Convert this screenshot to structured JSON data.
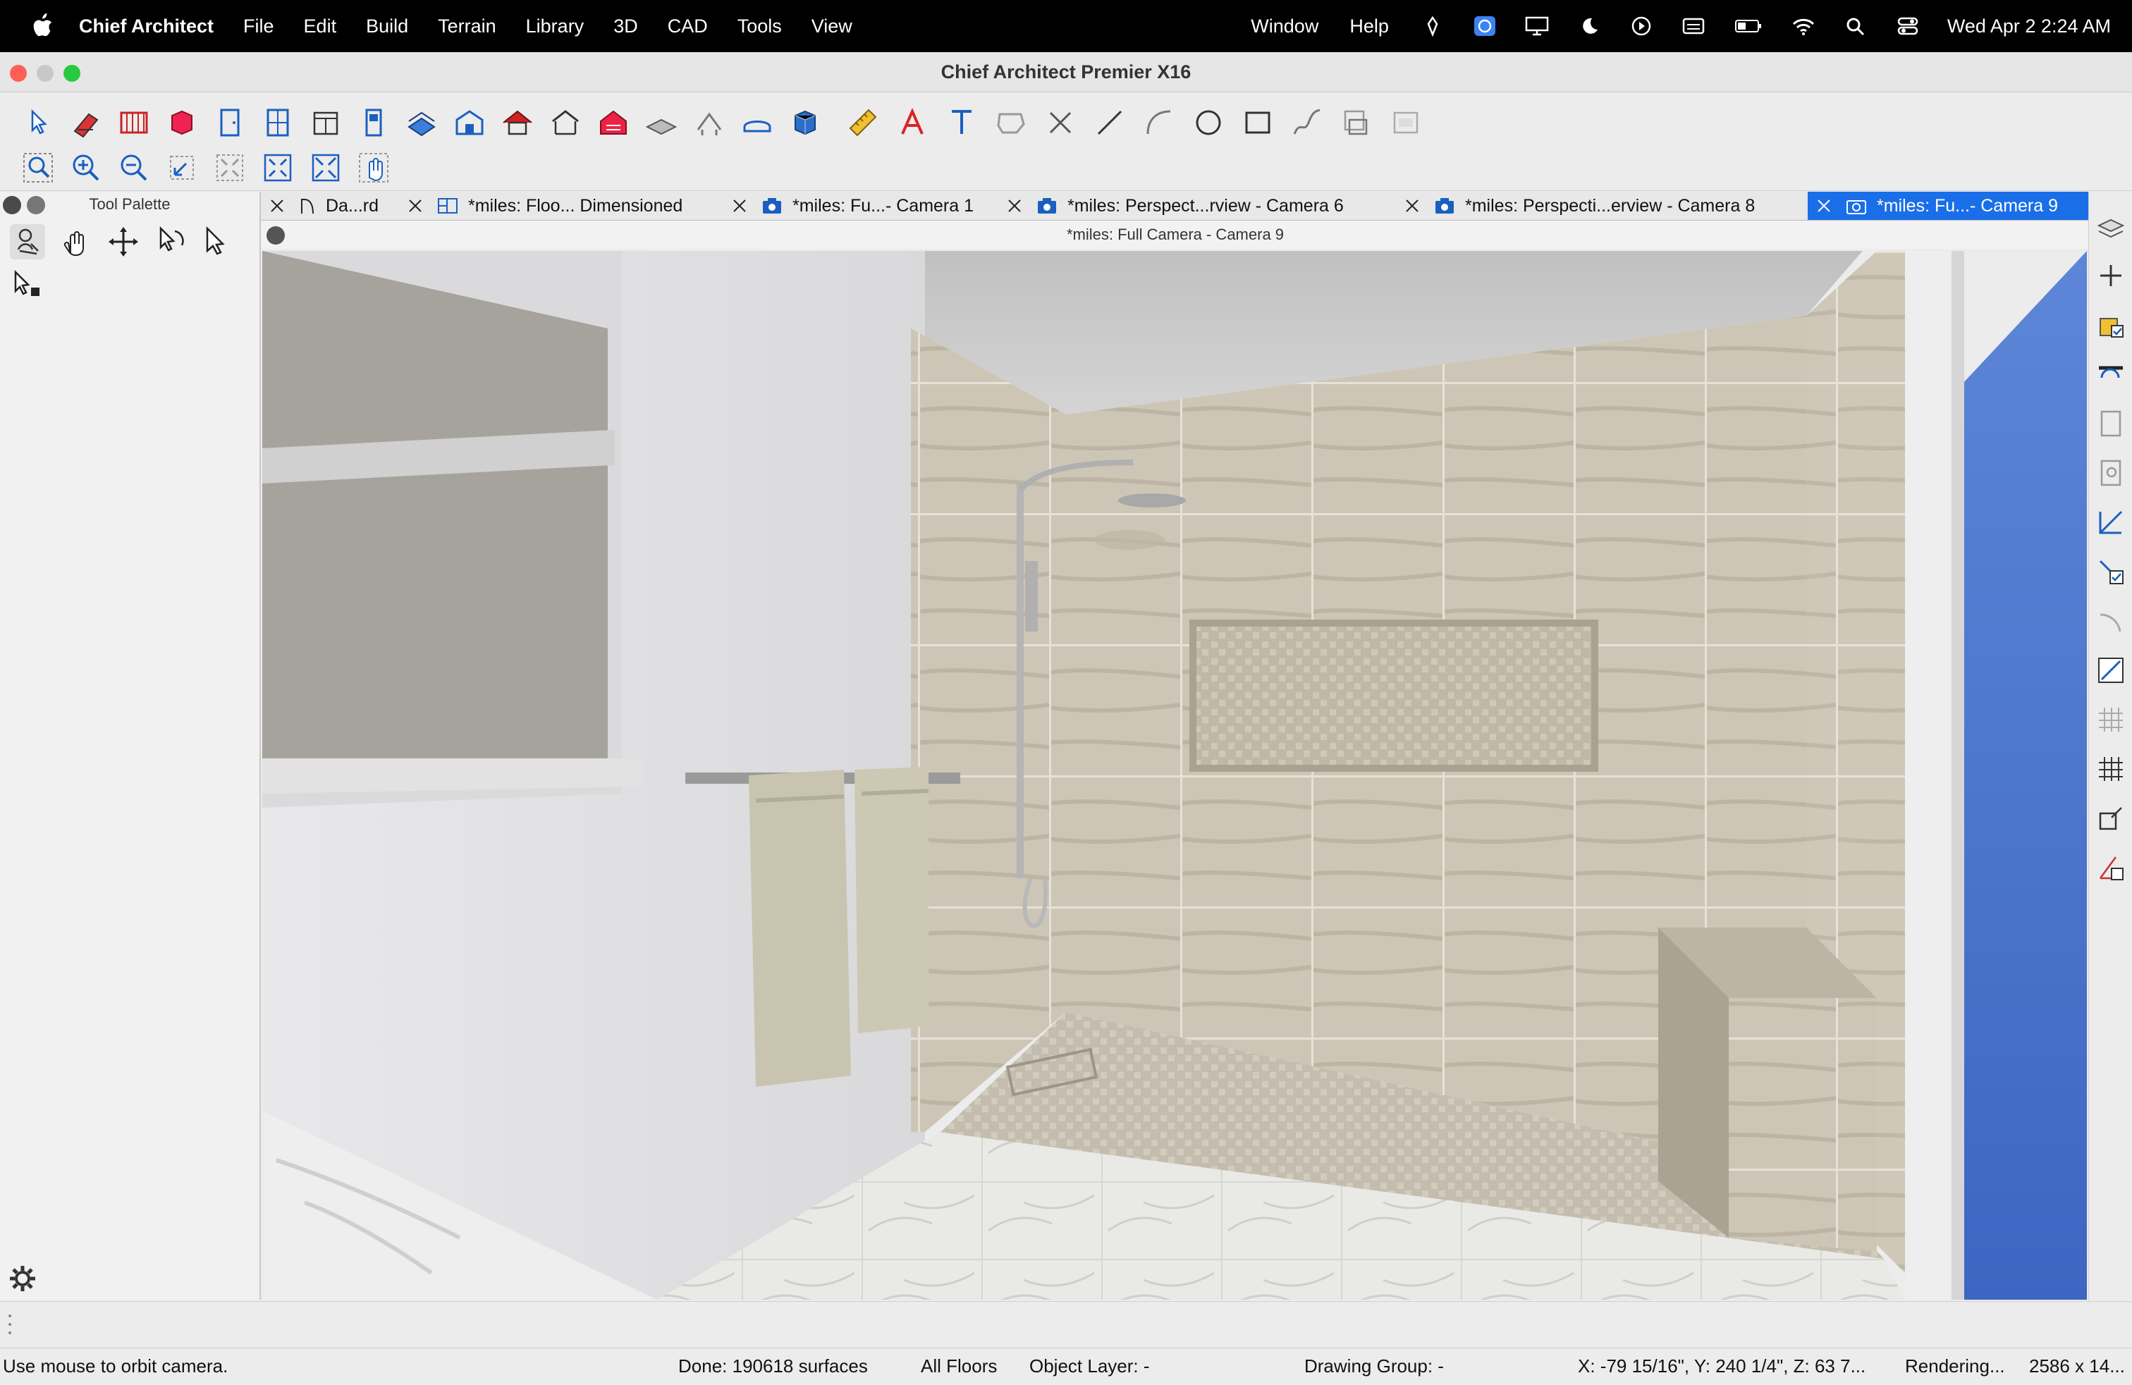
{
  "menubar": {
    "app_name": "Chief Architect",
    "menus": [
      "File",
      "Edit",
      "Build",
      "Terrain",
      "Library",
      "3D",
      "CAD",
      "Tools",
      "View"
    ],
    "right_menus": [
      "Window",
      "Help"
    ],
    "clock": "Wed Apr 2  2:24 AM"
  },
  "window": {
    "title": "Chief Architect Premier X16"
  },
  "palette": {
    "title": "Tool Palette"
  },
  "tabs": [
    {
      "label": "Da...rd",
      "icon": "layout-icon",
      "active": false
    },
    {
      "label": "*miles: Floo... Dimensioned",
      "icon": "plan-icon",
      "active": false
    },
    {
      "label": "*miles: Fu...- Camera 1",
      "icon": "camera-icon",
      "active": false
    },
    {
      "label": "*miles: Perspect...rview - Camera 6",
      "icon": "camera-icon",
      "active": false
    },
    {
      "label": "*miles: Perspecti...erview - Camera 8",
      "icon": "camera-icon",
      "active": false
    },
    {
      "label": "*miles: Fu...- Camera 9",
      "icon": "camera-icon",
      "active": true
    }
  ],
  "view": {
    "title": "*miles: Full Camera - Camera 9"
  },
  "status": {
    "hint": "Use mouse to orbit camera.",
    "done": "Done:  190618 surfaces",
    "floors": "All Floors",
    "object_layer": "Object Layer: -",
    "drawing_group": "Drawing Group: -",
    "coords": "X: -79 15/16\", Y: 240 1/4\", Z: 63 7...",
    "rendering": "Rendering...",
    "size": "2586 x 14..."
  },
  "colors": {
    "accent": "#1a6fe8",
    "tile": "#cfc8b8",
    "wall": "#e4e4e6"
  }
}
